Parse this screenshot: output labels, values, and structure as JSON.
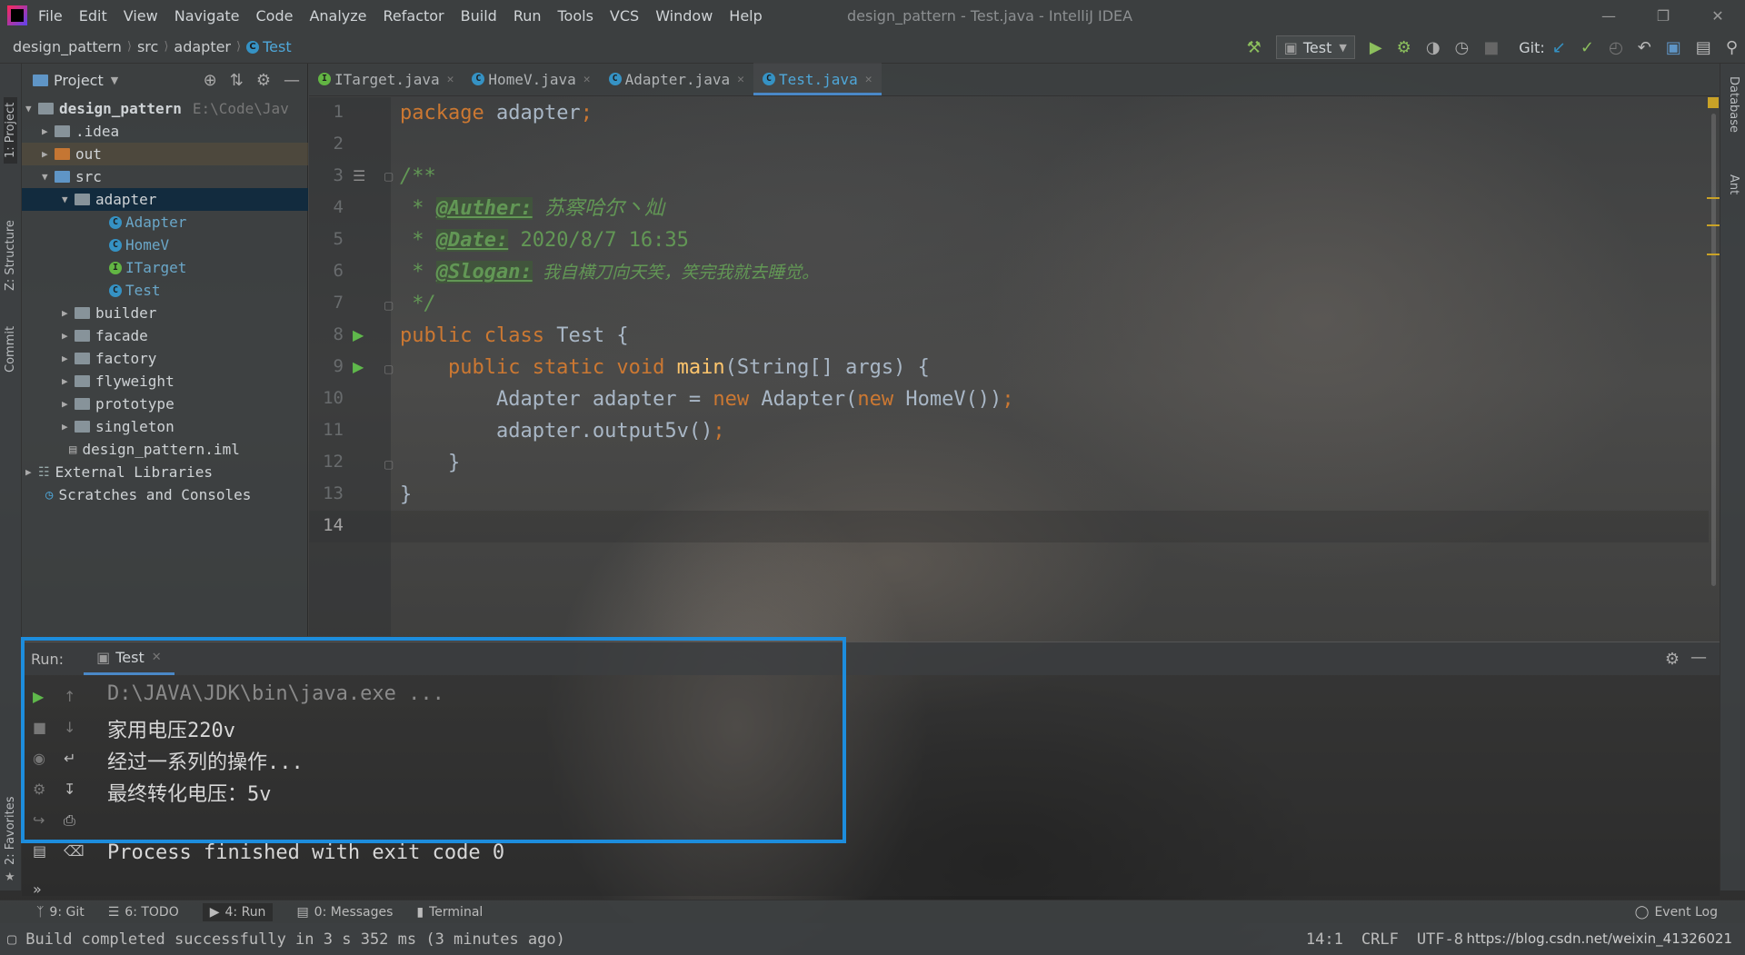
{
  "window": {
    "title": "design_pattern - Test.java - IntelliJ IDEA",
    "menu": [
      "File",
      "Edit",
      "View",
      "Navigate",
      "Code",
      "Analyze",
      "Refactor",
      "Build",
      "Run",
      "Tools",
      "VCS",
      "Window",
      "Help"
    ]
  },
  "breadcrumb": [
    "design_pattern",
    "src",
    "adapter",
    "Test"
  ],
  "toolbar": {
    "run_config": "Test",
    "git_label": "Git:"
  },
  "project": {
    "header": "Project",
    "root": "design_pattern",
    "root_path": "E:\\Code\\Jav",
    "items": {
      "idea": ".idea",
      "out": "out",
      "src": "src",
      "adapter": "adapter",
      "Adapter": "Adapter",
      "HomeV": "HomeV",
      "ITarget": "ITarget",
      "Test": "Test",
      "builder": "builder",
      "facade": "facade",
      "factory": "factory",
      "flyweight": "flyweight",
      "prototype": "prototype",
      "singleton": "singleton",
      "iml": "design_pattern.iml",
      "ext": "External Libraries",
      "scratch": "Scratches and Consoles"
    }
  },
  "side_tabs": {
    "project": "1: Project",
    "structure": "Z: Structure",
    "commit": "Commit",
    "favorites": "2: Favorites",
    "database": "Database",
    "ant": "Ant"
  },
  "tabs": [
    "ITarget.java",
    "HomeV.java",
    "Adapter.java",
    "Test.java"
  ],
  "code": {
    "line_numbers": [
      "1",
      "2",
      "3",
      "4",
      "5",
      "6",
      "7",
      "8",
      "9",
      "10",
      "11",
      "12",
      "13",
      "14"
    ],
    "l1_kw": "package",
    "l1_rest": " adapter",
    "l1_semi": ";",
    "l3": "/**",
    "l4_star": " * ",
    "l4_tag": "@Auther:",
    "l4_text": " 苏察哈尔丶灿",
    "l5_star": " * ",
    "l5_tag": "@Date:",
    "l5_text": " 2020/8/7 16:35",
    "l6_star": " * ",
    "l6_tag": "@Slogan:",
    "l6_text": " 我自横刀向天笑，笑完我就去睡觉。",
    "l7": " */",
    "l8_kw": "public class",
    "l8_rest": " Test {",
    "l9_kw": "    public static void",
    "l9_fn": " main",
    "l9_rest": "(String[] args) {",
    "l10_a": "        Adapter adapter = ",
    "l10_new1": "new",
    "l10_b": " Adapter(",
    "l10_new2": "new",
    "l10_c": " HomeV())",
    "l10_semi": ";",
    "l11_a": "        adapter.output5v()",
    "l11_semi": ";",
    "l12": "    }",
    "l13": "}"
  },
  "run": {
    "label": "Run:",
    "tab": "Test",
    "output": [
      "D:\\JAVA\\JDK\\bin\\java.exe ...",
      "家用电压220v",
      "经过一系列的操作...",
      "最终转化电压：5v",
      "",
      "Process finished with exit code 0"
    ]
  },
  "bottom_tools": {
    "git": "9: Git",
    "todo": "6: TODO",
    "run": "4: Run",
    "messages": "0: Messages",
    "terminal": "Terminal",
    "event_log": "Event Log"
  },
  "status": {
    "message": "Build completed successfully in 3 s 352 ms (3 minutes ago)",
    "position": "14:1",
    "line_sep": "CRLF",
    "encoding": "UTF-8",
    "watermark": "https://blog.csdn.net/weixin_41326021"
  },
  "colors": {
    "accent": "#4a88c7",
    "highlight_box": "#1d8ddd",
    "keyword": "#cc7832",
    "doc_comment": "#629755",
    "method": "#ffc66d"
  }
}
